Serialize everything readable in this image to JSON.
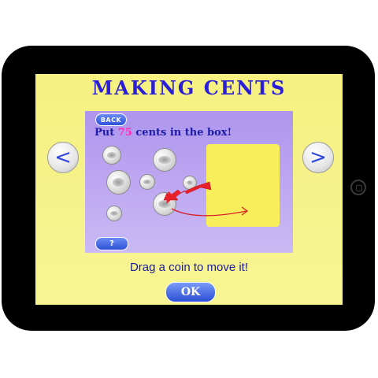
{
  "game": {
    "title": "MAKING CENTS",
    "back_label": "BACK",
    "prompt_before": "Put ",
    "prompt_amount": "75",
    "prompt_after": " cents in the box!",
    "help_label": "?",
    "instruction": "Drag a coin to move it!",
    "ok_label": "OK"
  },
  "nav": {
    "prev_label": "<",
    "next_label": ">"
  },
  "coins": [
    "quarter",
    "quarter",
    "quarter",
    "dime",
    "quarter",
    "quarter",
    "dime"
  ],
  "colors": {
    "title": "#2a1fd6",
    "amount": "#ff2bb5",
    "drop_box": "#f8ee5b",
    "arrow": "#e8202a"
  }
}
